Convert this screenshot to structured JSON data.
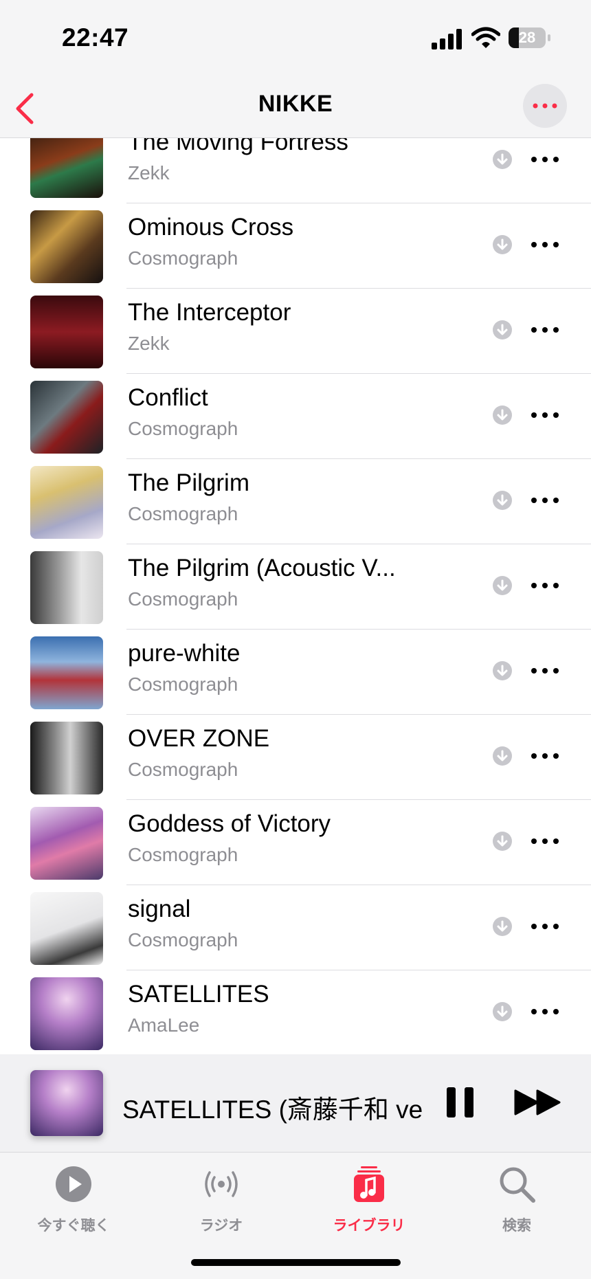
{
  "status": {
    "time": "22:47",
    "battery_level": "28",
    "battery_fraction": 0.28
  },
  "nav": {
    "title": "NIKKE"
  },
  "colors": {
    "accent": "#fa2d48",
    "secondary_text": "#8e8e93"
  },
  "tracks": [
    {
      "title": "The Moving Fortress",
      "artist": "Zekk"
    },
    {
      "title": "Ominous Cross",
      "artist": "Cosmograph"
    },
    {
      "title": "The Interceptor",
      "artist": "Zekk"
    },
    {
      "title": "Conflict",
      "artist": "Cosmograph"
    },
    {
      "title": "The Pilgrim",
      "artist": "Cosmograph"
    },
    {
      "title": "The Pilgrim (Acoustic V...",
      "artist": "Cosmograph"
    },
    {
      "title": "pure-white",
      "artist": "Cosmograph"
    },
    {
      "title": "OVER ZONE",
      "artist": "Cosmograph"
    },
    {
      "title": "Goddess of Victory",
      "artist": "Cosmograph"
    },
    {
      "title": "signal",
      "artist": "Cosmograph"
    },
    {
      "title": "SATELLITES",
      "artist": "AmaLee"
    }
  ],
  "now_playing": {
    "title": "SATELLITES (斎藤千和 ve..."
  },
  "tabs": [
    {
      "label": "今すぐ聴く",
      "icon": "play-circle-icon",
      "active": false
    },
    {
      "label": "ラジオ",
      "icon": "radio-broadcast-icon",
      "active": false
    },
    {
      "label": "ライブラリ",
      "icon": "music-library-icon",
      "active": true
    },
    {
      "label": "検索",
      "icon": "search-icon",
      "active": false
    }
  ]
}
